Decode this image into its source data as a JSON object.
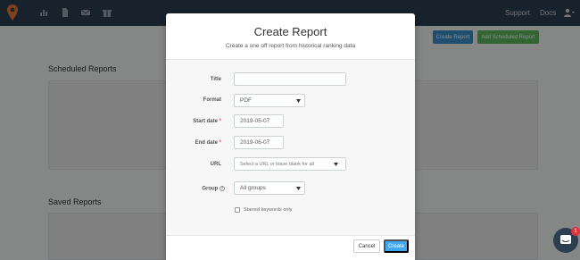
{
  "navbar": {
    "links": {
      "support": "Support",
      "docs": "Docs"
    },
    "icons": [
      "chart-icon",
      "document-icon",
      "mail-icon",
      "gift-icon",
      "user-icon"
    ]
  },
  "toolbar": {
    "create_report_label": "Create Report",
    "add_scheduled_label": "Add Scheduled Report"
  },
  "sections": {
    "scheduled_title": "Scheduled Reports",
    "saved_title": "Saved Reports"
  },
  "modal": {
    "title": "Create Report",
    "subtitle": "Create a one off report from historical ranking data",
    "fields": {
      "title_label": "Title",
      "title_value": "",
      "format_label": "Format",
      "format_value": "PDF",
      "start_label": "Start date",
      "start_value": "2019-05-07",
      "end_label": "End date",
      "end_value": "2019-06-07",
      "url_label": "URL",
      "url_placeholder": "Select a URL or leave blank for all",
      "group_label": "Group",
      "group_value": "All groups",
      "starred_label": "Starred keywords only",
      "required_mark": "*"
    },
    "cancel_label": "Cancel",
    "create_label": "Create"
  },
  "chat": {
    "badge_count": "1"
  },
  "colors": {
    "navbar": "#2c3e50",
    "primary": "#3a8ec9",
    "success": "#5cb85c",
    "create_button": "#3fa9f5",
    "required": "#e74c3c",
    "badge": "#e0323c"
  }
}
